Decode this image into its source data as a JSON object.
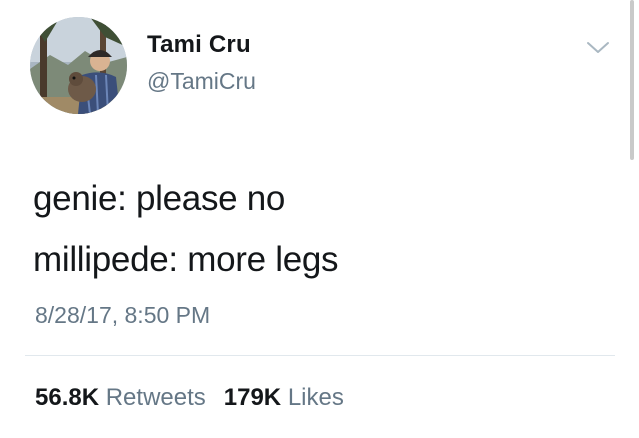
{
  "user": {
    "display_name": "Tami Cru",
    "handle": "@TamiCru",
    "avatar_icon": "profile-photo"
  },
  "menu": {
    "icon": "chevron-down-icon"
  },
  "tweet": {
    "lines": [
      "genie: please no",
      "millipede: more legs"
    ],
    "timestamp": "8/28/17, 8:50 PM"
  },
  "stats": {
    "retweets_count": "56.8K",
    "retweets_label": "Retweets",
    "likes_count": "179K",
    "likes_label": "Likes"
  },
  "colors": {
    "primary_text": "#14171a",
    "secondary_text": "#657786",
    "divider": "#e1e8ed"
  }
}
